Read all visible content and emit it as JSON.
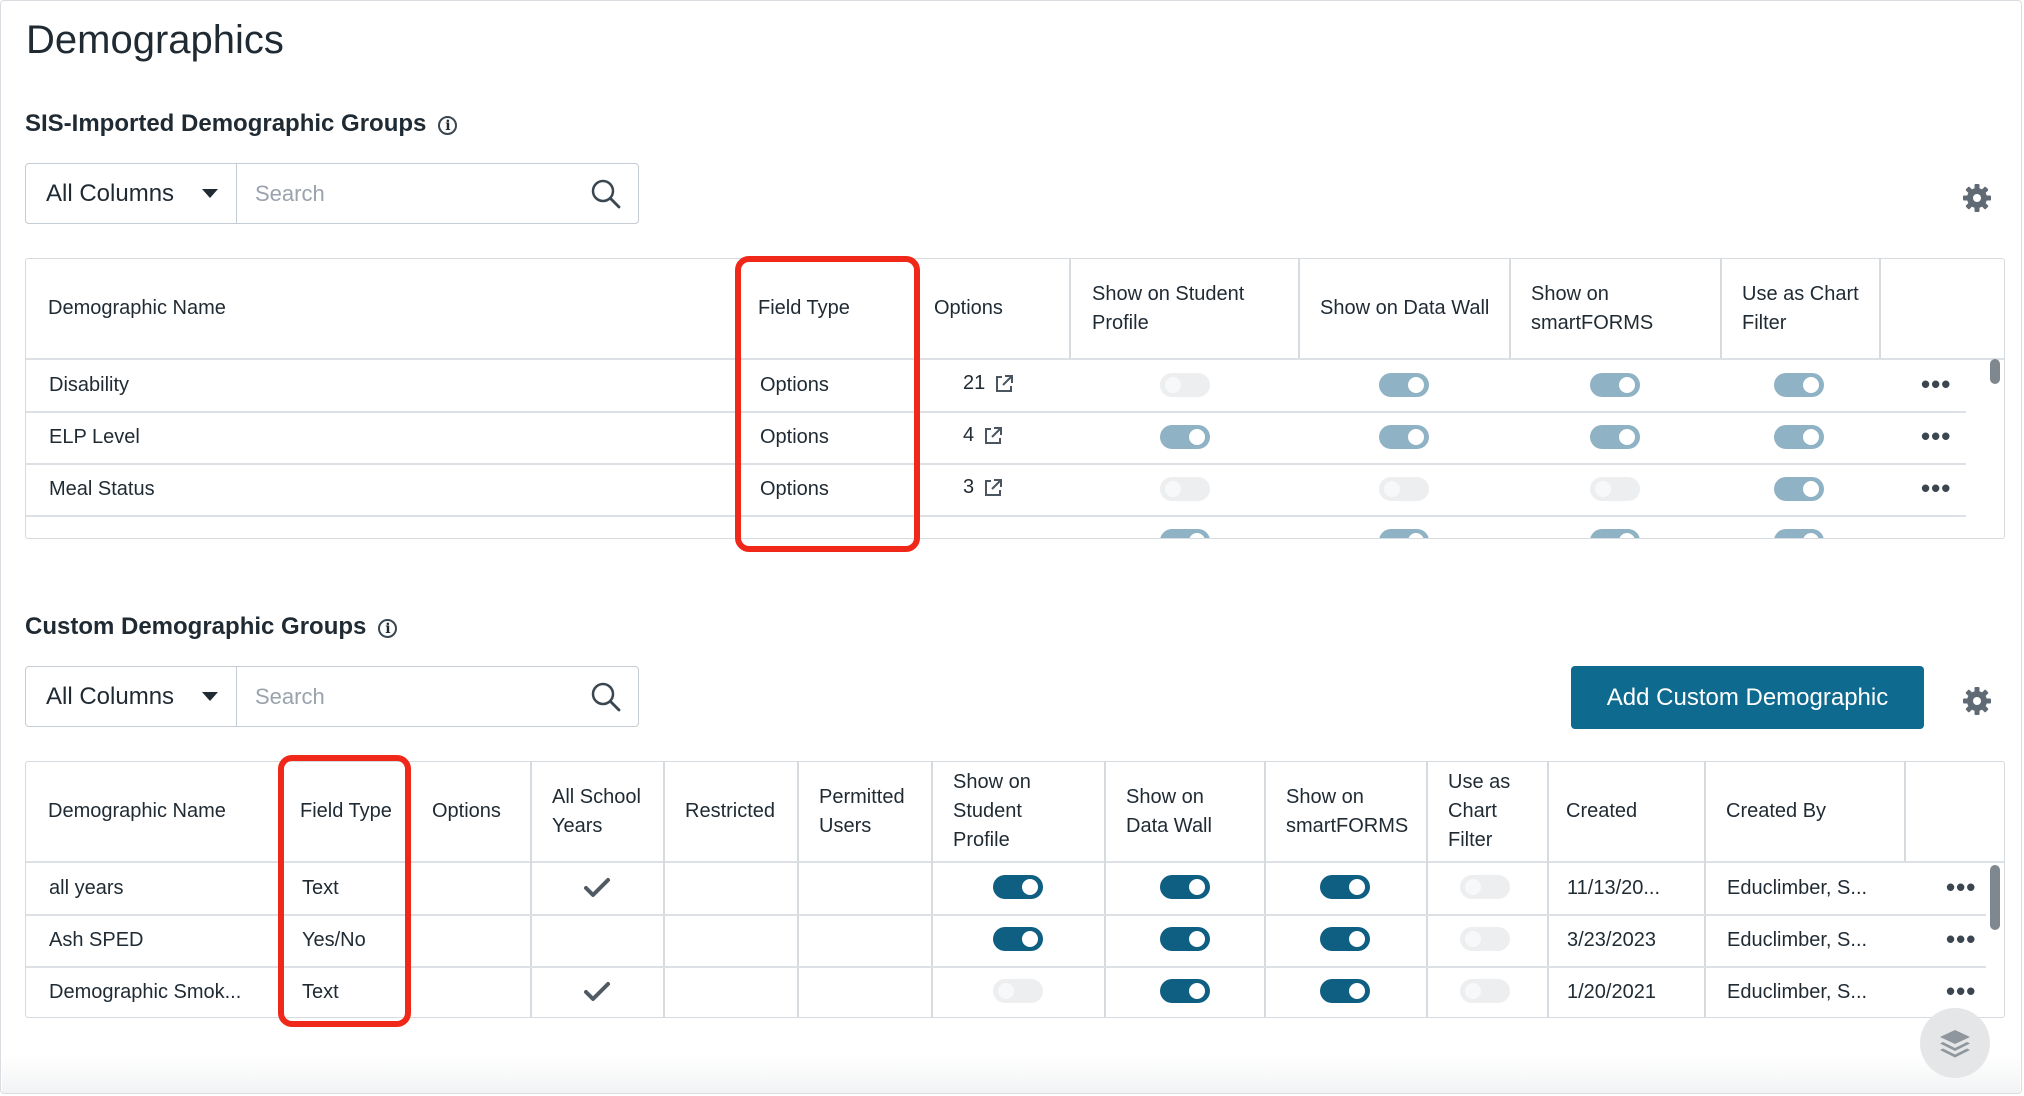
{
  "page": {
    "title": "Demographics"
  },
  "sis": {
    "title": "SIS-Imported Demographic Groups",
    "filter": {
      "selected": "All Columns",
      "placeholder": "Search"
    },
    "headers": {
      "name": "Demographic Name",
      "field_type": "Field Type",
      "options": "Options",
      "student_profile": "Show on Student Profile",
      "data_wall": "Show on Data Wall",
      "smartforms": "Show on smartFORMS",
      "chart_filter": "Use as Chart Filter"
    },
    "rows": [
      {
        "name": "Disability",
        "field_type": "Options",
        "options": "21",
        "student_profile": false,
        "data_wall": true,
        "smartforms": true,
        "chart_filter": true
      },
      {
        "name": "ELP Level",
        "field_type": "Options",
        "options": "4",
        "student_profile": true,
        "data_wall": true,
        "smartforms": true,
        "chart_filter": true
      },
      {
        "name": "Meal Status",
        "field_type": "Options",
        "options": "3",
        "student_profile": false,
        "data_wall": false,
        "smartforms": false,
        "chart_filter": true
      }
    ]
  },
  "custom": {
    "title": "Custom Demographic Groups",
    "filter": {
      "selected": "All Columns",
      "placeholder": "Search"
    },
    "add_button": "Add Custom Demographic",
    "headers": {
      "name": "Demographic Name",
      "field_type": "Field Type",
      "options": "Options",
      "all_years": "All School Years",
      "restricted": "Restricted",
      "permitted": "Permitted Users",
      "student_profile": "Show on Student Profile",
      "data_wall": "Show on Data Wall",
      "smartforms": "Show on smartFORMS",
      "chart_filter": "Use as Chart Filter",
      "created": "Created",
      "created_by": "Created By"
    },
    "rows": [
      {
        "name": "all years",
        "field_type": "Text",
        "all_years": true,
        "student_profile": true,
        "data_wall": true,
        "smartforms": true,
        "chart_filter": false,
        "created": "11/13/20...",
        "created_by": "Educlimber, S..."
      },
      {
        "name": "Ash SPED",
        "field_type": "Yes/No",
        "all_years": false,
        "student_profile": true,
        "data_wall": true,
        "smartforms": true,
        "chart_filter": false,
        "created": "3/23/2023",
        "created_by": "Educlimber, S..."
      },
      {
        "name": "Demographic Smok...",
        "field_type": "Text",
        "all_years": true,
        "student_profile": false,
        "data_wall": true,
        "smartforms": true,
        "chart_filter": false,
        "created": "1/20/2021",
        "created_by": "Educlimber, S..."
      }
    ]
  },
  "icons": {
    "info": "info-icon",
    "search": "search-icon",
    "settings": "gear-icon",
    "external": "external-link-icon",
    "more": "more-horizontal-icon",
    "check": "checkmark-icon",
    "layers": "layers-icon"
  },
  "colors": {
    "accent": "#0e6a8e",
    "highlight": "#f0281a",
    "toggle_on_dark": "#0e5f82",
    "toggle_on_light": "#8fb2c5"
  }
}
